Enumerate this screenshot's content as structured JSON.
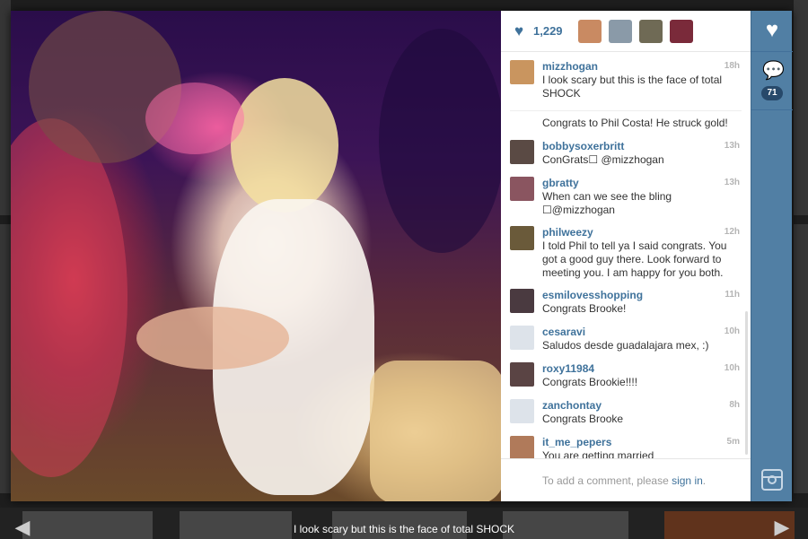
{
  "likes": {
    "count": "1,229",
    "icon": "heart-icon",
    "color": "#3f729b"
  },
  "likers": [
    {
      "name": "liker-1",
      "color": "#c98a62"
    },
    {
      "name": "liker-2",
      "color": "#8a9aa8"
    },
    {
      "name": "liker-3",
      "color": "#6f6a55"
    },
    {
      "name": "liker-4",
      "color": "#7a2a3a"
    }
  ],
  "comments": [
    {
      "user": "mizzhogan",
      "time": "18h",
      "text": "I look scary but this is the face of total SHOCK",
      "avatar": "#c9955f"
    },
    {
      "user": "",
      "time": "",
      "text": "Congrats to Phil Costa! He struck gold!",
      "avatar": ""
    },
    {
      "user": "bobbysoxerbritt",
      "time": "13h",
      "text": "ConGrats☐ @mizzhogan",
      "avatar": "#5a4a44"
    },
    {
      "user": "gbratty",
      "time": "13h",
      "text": "When can we see the bling ☐@mizzhogan",
      "avatar": "#8a5560"
    },
    {
      "user": "philweezy",
      "time": "12h",
      "text": "I told Phil to tell ya I said congrats. You got a good guy there. Look forward to meeting you. I am happy for you both.",
      "avatar": "#6a5a3a"
    },
    {
      "user": "esmilovesshopping",
      "time": "11h",
      "text": "Congrats Brooke!",
      "avatar": "#4a3a40"
    },
    {
      "user": "cesaravi",
      "time": "10h",
      "text": "Saludos desde guadalajara mex, :)",
      "avatar": "#dde3ea"
    },
    {
      "user": "roxy11984",
      "time": "10h",
      "text": "Congrats Brookie!!!!",
      "avatar": "#5a4444"
    },
    {
      "user": "zanchontay",
      "time": "8h",
      "text": "Congrats Brooke",
      "avatar": "#dde3ea"
    },
    {
      "user": "it_me_pepers",
      "time": "5m",
      "text": "You are getting married",
      "avatar": "#b07a5a"
    }
  ],
  "comment_box": {
    "prompt": "To add a comment, please",
    "link": "sign in",
    "suffix": "."
  },
  "rail": {
    "heart_icon": "heart-icon",
    "comment_icon": "comment-bubble-icon",
    "comment_count": "71",
    "logo": "instagram-logo-icon",
    "color": "#517fa4"
  },
  "caption": "I look scary but this is the face of total SHOCK",
  "nav": {
    "prev_icon": "arrow-left-icon",
    "next_icon": "arrow-right-icon"
  }
}
